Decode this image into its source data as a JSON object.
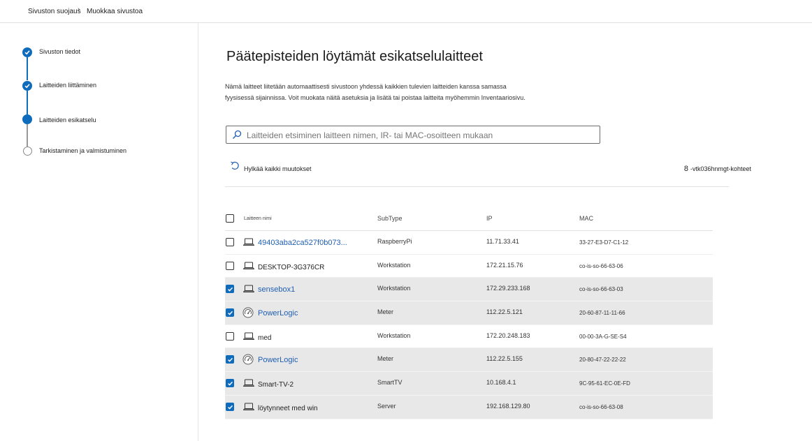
{
  "breadcrumb": {
    "items": [
      "Sivuston suojaus",
      "Muokkaa sivustoa"
    ]
  },
  "steps": [
    {
      "label": "Sivuston tiedot",
      "state": "done"
    },
    {
      "label": "Laitteiden liittäminen",
      "state": "done"
    },
    {
      "label": "Laitteiden esikatselu",
      "state": "current"
    },
    {
      "label": "Tarkistaminen ja valmistuminen",
      "state": "pending"
    }
  ],
  "main": {
    "title": "Päätepisteiden löytämät esikatselulaitteet",
    "description": "Nämä laitteet liitetään automaattisesti sivustoon yhdessä kaikkien tulevien laitteiden kanssa samassa fyysisessä sijainnissa. Voit muokata näitä asetuksia ja lisätä tai poistaa laitteita myöhemmin Inventaariosivu.",
    "search_placeholder": "Laitteiden etsiminen laitteen nimen, IR- tai MAC-osoitteen mukaan",
    "discard_label": "Hylkää kaikki muutokset",
    "count_number": "8",
    "count_label": "-vtk036hnmgt-kohteet"
  },
  "table": {
    "headers": {
      "name": "Laitteen nimi",
      "subtype": "SubType",
      "ip": "IP",
      "mac": "MAC"
    },
    "rows": [
      {
        "name": "49403aba2ca527f0b073...",
        "subtype": "RaspberryPi",
        "ip": "11.71.33.41",
        "mac": "33-27-E3-D7-C1-12",
        "checked": false,
        "icon": "laptop-icon",
        "link": true
      },
      {
        "name": "DESKTOP-3G376CR",
        "subtype": "Workstation",
        "ip": "172.21.15.76",
        "mac": "co-is-so-66-63-06",
        "checked": false,
        "icon": "laptop-icon",
        "link": false
      },
      {
        "name": "sensebox1",
        "subtype": "Workstation",
        "ip": "172.29.233.168",
        "mac": "co-is-so-66-63-03",
        "checked": true,
        "icon": "laptop-icon",
        "link": true
      },
      {
        "name": "PowerLogic",
        "subtype": "Meter",
        "ip": "112.22.5.121",
        "mac": "20-60-87-11-11-66",
        "checked": true,
        "icon": "meter-icon",
        "link": true
      },
      {
        "name": "med",
        "subtype": "Workstation",
        "ip": "172.20.248.183",
        "mac": "00-00-3A-G-SE-S4",
        "checked": false,
        "icon": "laptop-icon",
        "link": false
      },
      {
        "name": "PowerLogic",
        "subtype": "Meter",
        "ip": "112.22.5.155",
        "mac": "20-80-47-22-22-22",
        "checked": true,
        "icon": "meter-icon",
        "link": true
      },
      {
        "name": "Smart-TV-2",
        "subtype": "SmartTV",
        "ip": "10.168.4.1",
        "mac": "9C-95-61-EC-0E-FD",
        "checked": true,
        "icon": "laptop-icon",
        "link": false
      },
      {
        "name": "löytynneet med win",
        "subtype": "Server",
        "ip": "192.168.129.80",
        "mac": "co-is-so-66-63-08",
        "checked": true,
        "icon": "laptop-icon",
        "link": false
      }
    ]
  },
  "colors": {
    "accent": "#0f6cbd",
    "link": "#1f5fb3",
    "selected_row": "#e8e8e8"
  }
}
